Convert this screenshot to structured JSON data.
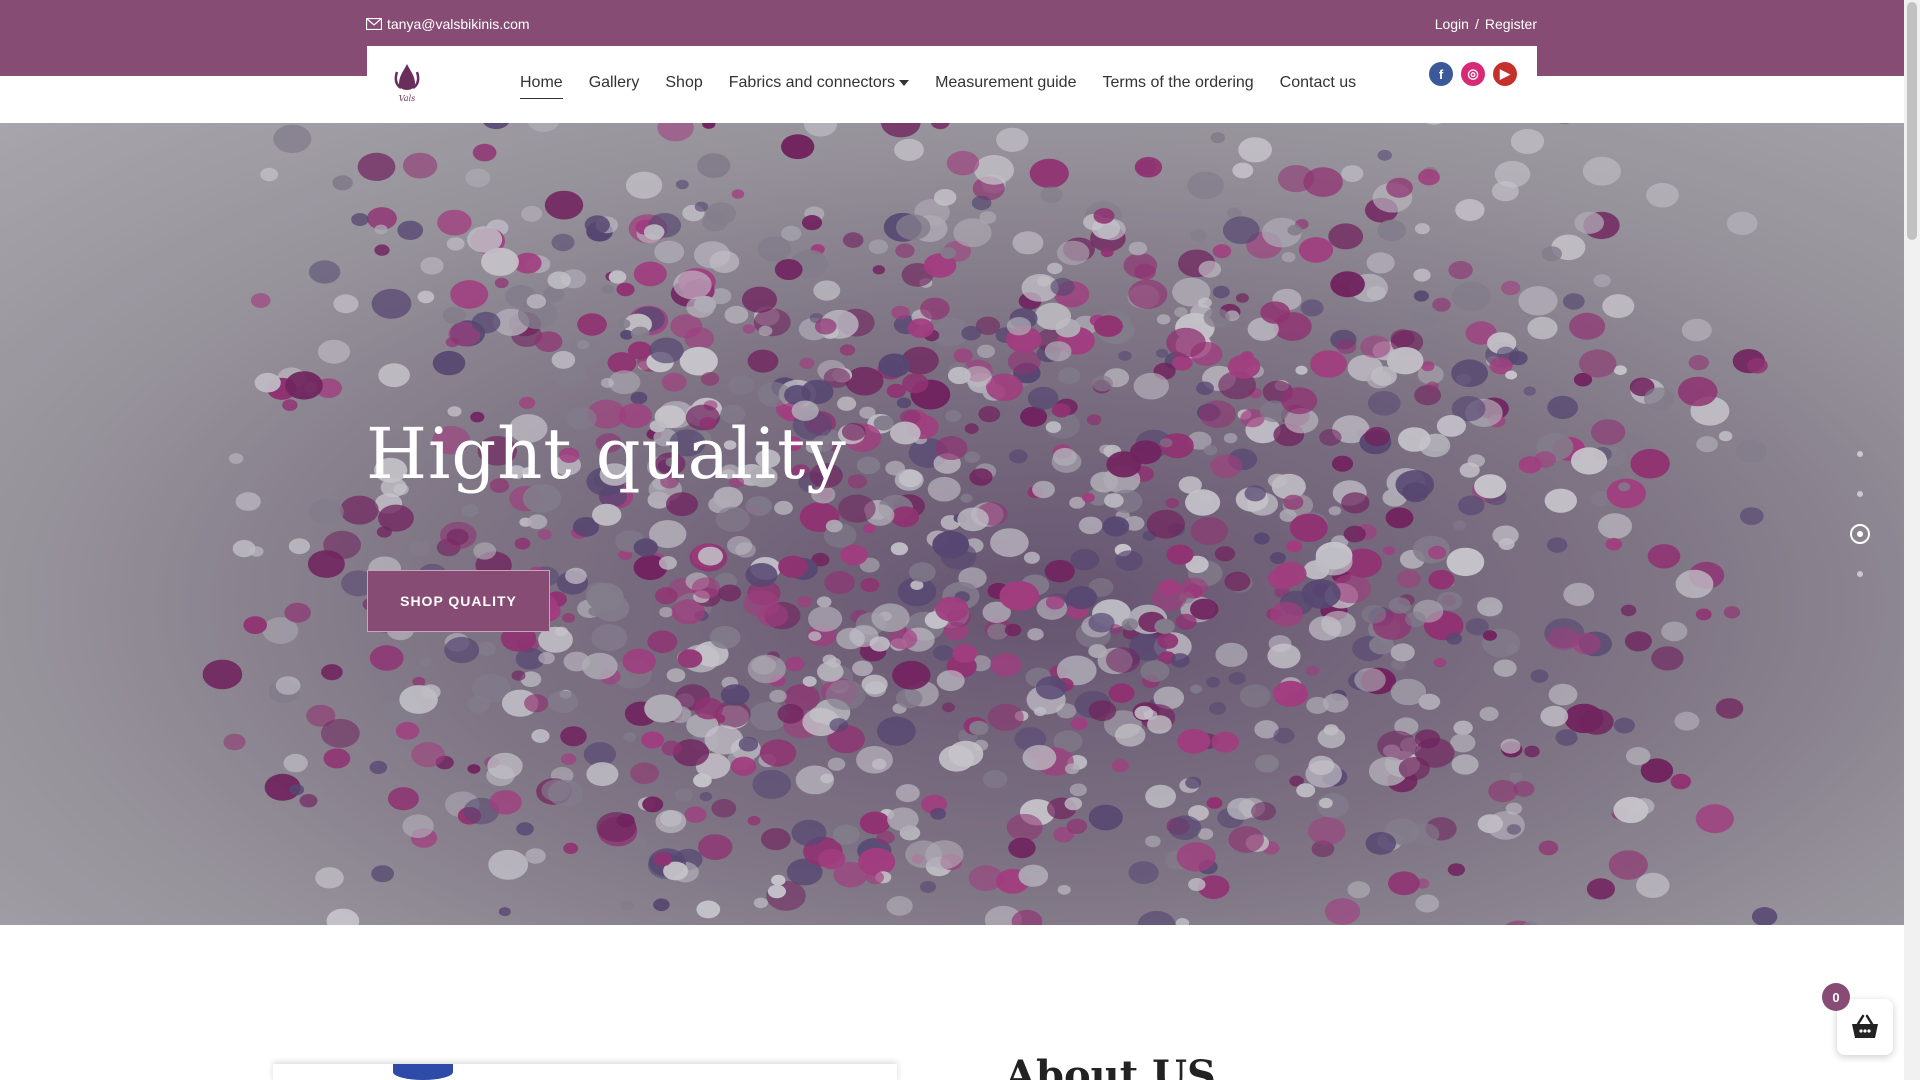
{
  "topbar": {
    "email": "tanya@valsbikinis.com",
    "login": "Login",
    "separator": "/",
    "register": "Register"
  },
  "nav": {
    "items": [
      {
        "label": "Home",
        "active": true
      },
      {
        "label": "Gallery"
      },
      {
        "label": "Shop"
      },
      {
        "label": "Fabrics and connectors",
        "dropdown": true
      },
      {
        "label": "Measurement guide"
      },
      {
        "label": "Terms of the ordering"
      },
      {
        "label": "Contact us"
      }
    ],
    "social": [
      {
        "icon": "facebook-icon",
        "glyph": "f",
        "color": "#3b5998"
      },
      {
        "icon": "instagram-icon",
        "glyph": "◎",
        "color": "#d62976"
      },
      {
        "icon": "youtube-icon",
        "glyph": "▶",
        "color": "#c4302b"
      }
    ]
  },
  "hero": {
    "title": "Hight quality",
    "button": "SHOP QUALITY",
    "slides": 4,
    "active_slide": 3
  },
  "about": {
    "title": "About US"
  },
  "cart": {
    "count": "0"
  },
  "colors": {
    "brand": "#874c74"
  }
}
